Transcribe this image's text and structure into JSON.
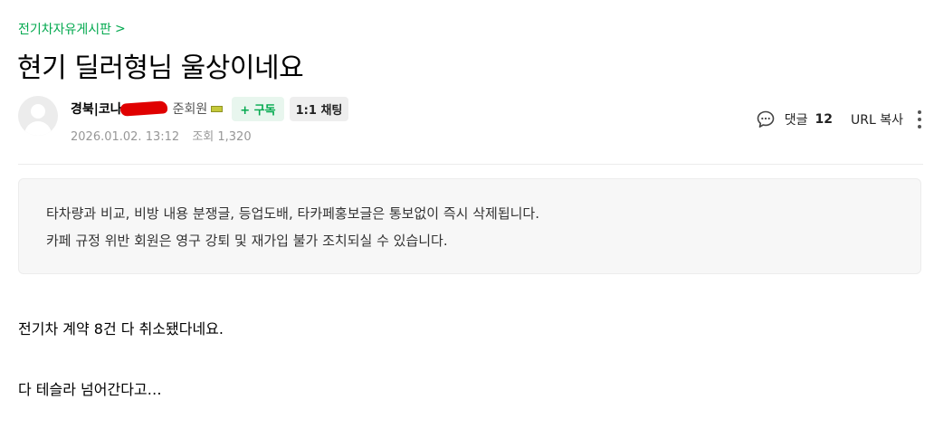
{
  "board": {
    "name": "전기차자유게시판",
    "chevron": ">"
  },
  "post": {
    "title": "현기 딜러형님 울상이네요",
    "author": {
      "nickname": "경북|코나",
      "grade": "준회원",
      "subscribe_label": "+ 구독",
      "chat_label": "1:1 채팅"
    },
    "date": "2026.01.02. 13:12",
    "views_label": "조회",
    "views": "1,320",
    "actions": {
      "comment_label": "댓글",
      "comment_count": "12",
      "url_copy_label": "URL 복사"
    }
  },
  "notice": {
    "line1": "타차량과 비교, 비방 내용 분쟁글, 등업도배, 타카페홍보글은 통보없이 즉시 삭제됩니다.",
    "line2": "카페 규정 위반 회원은 영구 강퇴 및 재가입 불가 조치되실 수 있습니다."
  },
  "content": {
    "paragraph1": "전기차 계약 8건 다 취소됐다네요.",
    "paragraph2": "다 테슬라 넘어간다고…"
  },
  "colors": {
    "accent": "#03a94f",
    "redaction": "#e00000"
  },
  "icons": [
    "chevron-right-icon",
    "default-avatar-icon",
    "grade-icon",
    "comment-icon",
    "more-vertical-icon"
  ]
}
